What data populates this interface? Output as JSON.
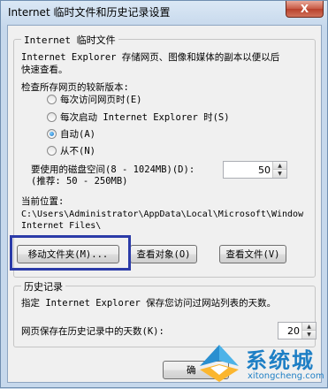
{
  "window": {
    "title": "Internet 临时文件和历史记录设置",
    "close_label": "X"
  },
  "temp_files": {
    "group_title": "Internet 临时文件",
    "description_line1": "Internet Explorer 存储网页、图像和媒体的副本以便以后",
    "description_line2": "快速查看。",
    "check_label": "检查所存网页的较新版本:",
    "options": [
      {
        "label": "每次访问网页时(E)",
        "checked": false
      },
      {
        "label": "每次启动 Internet Explorer 时(S)",
        "checked": false
      },
      {
        "label": "自动(A)",
        "checked": true
      },
      {
        "label": "从不(N)",
        "checked": false
      }
    ],
    "disk_label": "要使用的磁盘空间(8 - 1024MB)(D):",
    "disk_hint": "(推荐: 50 - 250MB)",
    "disk_value": "50",
    "location_label": "当前位置:",
    "location_path_line1": "C:\\Users\\Administrator\\AppData\\Local\\Microsoft\\Window",
    "location_path_line2": "Internet Files\\",
    "move_folder_button": "移动文件夹(M)...",
    "view_objects_button": "查看对象(O)",
    "view_files_button": "查看文件(V)"
  },
  "history": {
    "group_title": "历史记录",
    "description": "指定 Internet Explorer 保存您访问过网站列表的天数。",
    "days_label": "网页保存在历史记录中的天数(K):",
    "days_value": "20"
  },
  "footer": {
    "ok_button": "确"
  },
  "watermark": {
    "text": "系统城",
    "url": "xitongcheng.com"
  },
  "colors": {
    "highlight_border": "#2b3ba8",
    "close_button": "#c75a45"
  }
}
